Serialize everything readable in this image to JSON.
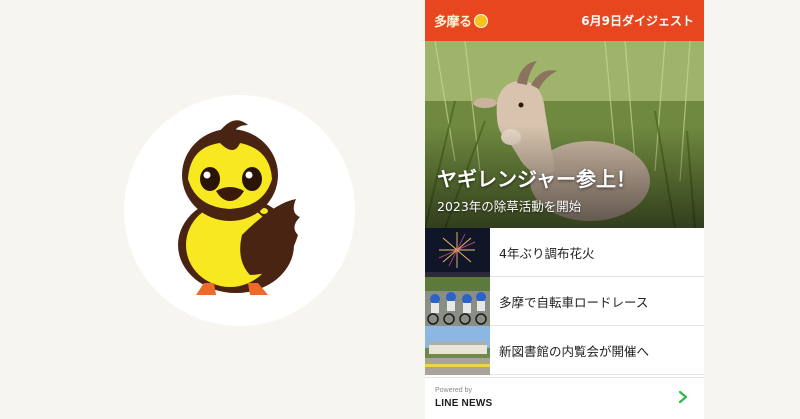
{
  "header": {
    "logo_text": "多摩る",
    "title": "6月9日ダイジェスト"
  },
  "hero": {
    "headline": "ヤギレンジャー参上！",
    "subtitle": "2023年の除草活動を開始"
  },
  "news": [
    {
      "label": "4年ぶり調布花火",
      "thumb_icon": "fireworks-thumbnail"
    },
    {
      "label": "多摩で自転車ロードレース",
      "thumb_icon": "cycling-race-thumbnail"
    },
    {
      "label": "新図書館の内覧会が開催へ",
      "thumb_icon": "library-building-thumbnail"
    }
  ],
  "footer": {
    "powered_by": "Powered by",
    "brand": "LINE NEWS",
    "chevron_icon": "chevron-right-icon"
  },
  "colors": {
    "header_bg": "#e8461e",
    "chevron": "#2fb84a",
    "page_bg": "#f7f5ef"
  }
}
